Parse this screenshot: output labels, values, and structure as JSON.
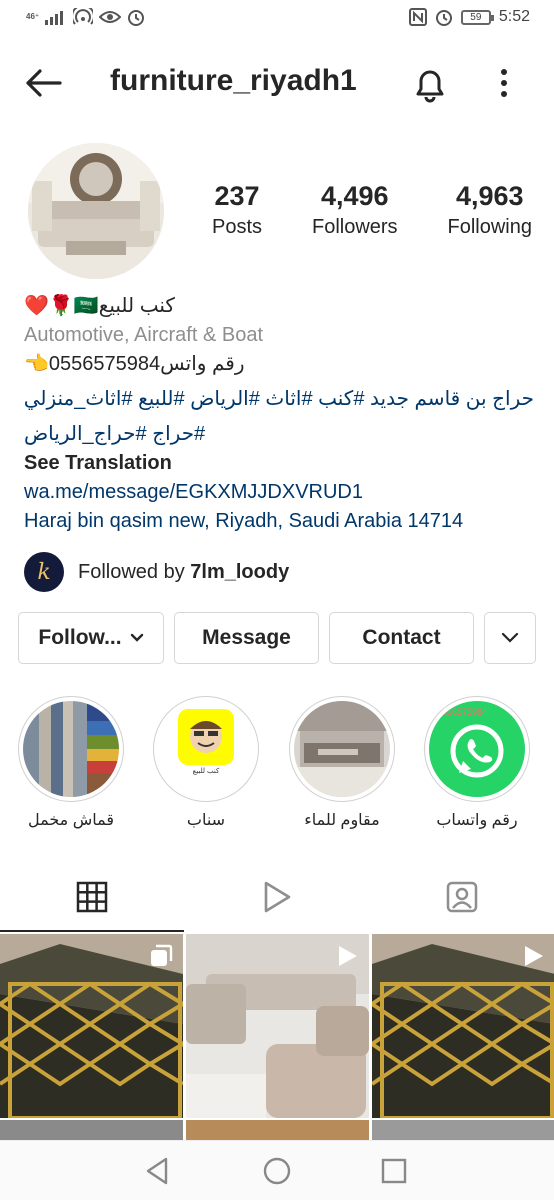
{
  "status_bar": {
    "network_label": "46⁺",
    "battery": "59",
    "time": "5:52"
  },
  "header": {
    "username": "furniture_riyadh1"
  },
  "stats": {
    "posts_count": "237",
    "posts_label": "Posts",
    "followers_count": "4,496",
    "followers_label": "Followers",
    "following_count": "4,963",
    "following_label": "Following"
  },
  "bio": {
    "name_line": "كنب للبيع🇸🇦🌹❤️",
    "category": "Automotive, Aircraft & Boat",
    "whatsapp_line": "رقم واتس0556575984👈",
    "hashtags_line1": "حراج بن قاسم جديد #كنب #اثاث #الرياض #للبيع #اثاث_منزلي",
    "hashtags_line2": "#حراج #حراج_الرياض",
    "see_translation": "See Translation",
    "link": "wa.me/message/EGKXMJJDXVRUD1",
    "address": "Haraj bin qasim new, Riyadh, Saudi Arabia 14714"
  },
  "followed_by": {
    "prefix": "Followed by ",
    "name": "7lm_loody"
  },
  "buttons": {
    "follow": "Follow...",
    "message": "Message",
    "contact": "Contact"
  },
  "highlights": [
    {
      "label": "قماش مخمل"
    },
    {
      "label": "سناب",
      "caption": "كنب للبيع"
    },
    {
      "label": "مقاوم للماء"
    },
    {
      "label": "رقم واتساب",
      "caption": "0556575984"
    }
  ],
  "colors": {
    "link_blue": "#00376b",
    "muted_gray": "#8e8e8e",
    "whatsapp_green": "#25d366",
    "snap_yellow": "#fffc00"
  }
}
